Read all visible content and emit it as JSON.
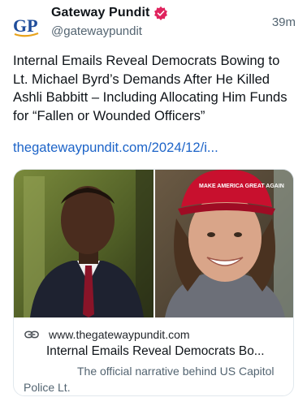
{
  "post": {
    "author_name": "Gateway Pundit",
    "author_handle": "@gatewaypundit",
    "timestamp": "39m",
    "avatar_logo_text": "GP",
    "text": "Internal Emails Reveal Democrats Bowing to Lt. Michael Byrd’s Demands After He Killed Ashli Babbitt – Including Allocating Him Funds for “Fallen or Wounded Officers”",
    "link_text": "thegatewaypundit.com/2024/12/i..."
  },
  "card": {
    "image_hat_text": "MAKE AMERICA GREAT AGAIN",
    "domain": "www.thegatewaypundit.com",
    "title": "Internal Emails Reveal Democrats Bo...",
    "description": "The official narrative behind US Capitol Police Lt."
  },
  "icons": {
    "verified": "verified-badge-icon",
    "link": "link-chain-icon"
  },
  "colors": {
    "link_blue": "#1d64c8",
    "verified_pink": "#e0245e",
    "logo_blue": "#1f4d9b",
    "hat_red": "#c8102e",
    "secondary_text": "#536471"
  }
}
